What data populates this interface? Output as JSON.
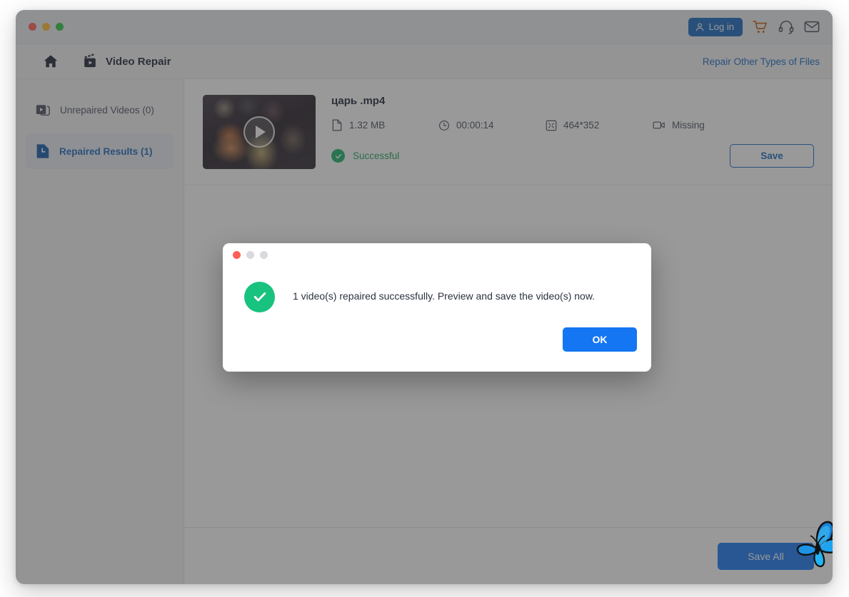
{
  "window": {
    "traffic_lights": [
      "close",
      "minimize",
      "maximize"
    ]
  },
  "titlebar": {
    "login_label": "Log in",
    "icons": [
      "user-icon",
      "cart-icon",
      "headset-icon",
      "envelope-icon"
    ]
  },
  "navbar": {
    "home_icon": "home-icon",
    "module_icon": "video-clapper-icon",
    "module_title": "Video Repair",
    "repair_other_link": "Repair Other Types of Files"
  },
  "sidebar": {
    "items": [
      {
        "label": "Unrepaired Videos (0)",
        "icon": "video-file-icon",
        "active": false
      },
      {
        "label": "Repaired Results (1)",
        "icon": "repaired-file-icon",
        "active": true
      }
    ]
  },
  "file_row": {
    "name": "царь .mp4",
    "thumbnail_alt": "video-thumbnail",
    "meta": [
      {
        "icon": "file-icon",
        "value": "1.32 MB"
      },
      {
        "icon": "clock-icon",
        "value": "00:00:14"
      },
      {
        "icon": "resolution-icon",
        "value": "464*352"
      },
      {
        "icon": "camera-icon",
        "value": "Missing"
      }
    ],
    "status": "Successful",
    "status_color": "#1aa35c",
    "save_label": "Save"
  },
  "footer": {
    "save_all_label": "Save All"
  },
  "dialog": {
    "message": "1 video(s) repaired successfully. Preview and save the video(s) now.",
    "ok_label": "OK",
    "check_color": "#18c27f",
    "traffic_lights": [
      "close",
      "minimize",
      "maximize"
    ]
  },
  "colors": {
    "accent_blue": "#1476f2",
    "link_blue": "#1566c0",
    "success_green": "#17b16b",
    "cart_orange": "#c25f12"
  },
  "cursor": {
    "icon": "butterfly-cursor"
  }
}
